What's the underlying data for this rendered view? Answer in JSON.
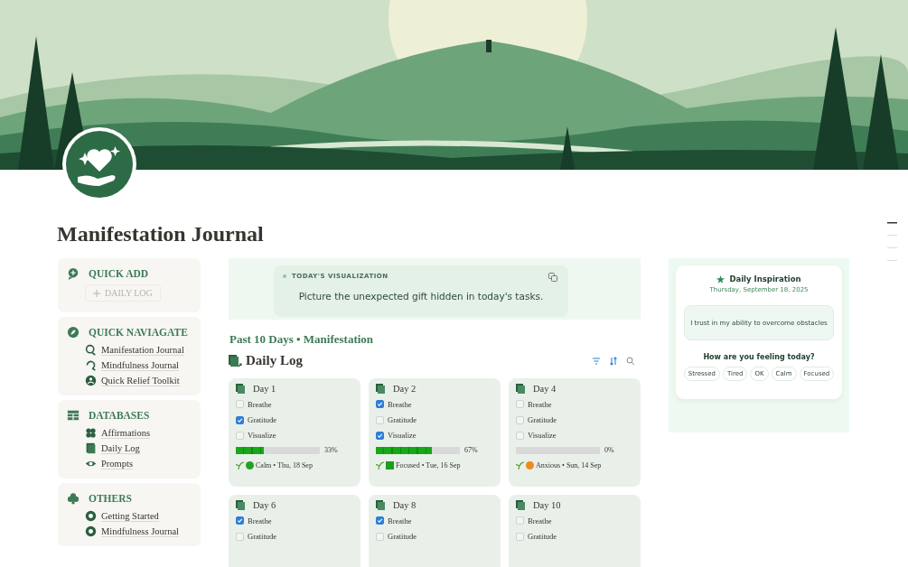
{
  "page": {
    "title": "Manifestation Journal"
  },
  "sidebar": [
    {
      "title": "QUICK ADD",
      "button": "DAILY LOG"
    },
    {
      "title": "QUICK NAVIAGATE",
      "items": [
        "Manifestation Journal",
        "Mindfulness Journal",
        "Quick Relief Toolkit"
      ]
    },
    {
      "title": "DATABASES",
      "items": [
        "Affirmations",
        "Daily Log",
        "Prompts"
      ]
    },
    {
      "title": "OTHERS",
      "items": [
        "Getting Started",
        "Mindfulness Journal"
      ]
    }
  ],
  "visualization": {
    "label": "TODAY'S VISUALIZATION",
    "text": "Picture the unexpected gift hidden in today's tasks."
  },
  "section_title": "Past 10 Days • Manifestation",
  "database": {
    "title": "Daily Log"
  },
  "days": [
    {
      "title": "Day 1",
      "tasks": [
        {
          "label": "Breathe",
          "checked": false
        },
        {
          "label": "Gratitude",
          "checked": true
        },
        {
          "label": "Visualize",
          "checked": false
        }
      ],
      "level": 0.33,
      "percent": "33%",
      "mood": {
        "kind": "circle",
        "color": "#22a322"
      },
      "footer": "Calm • Thu, 18 Sep"
    },
    {
      "title": "Day 2",
      "tasks": [
        {
          "label": "Breathe",
          "checked": true
        },
        {
          "label": "Gratitude",
          "checked": false
        },
        {
          "label": "Visualize",
          "checked": true
        }
      ],
      "level": 0.67,
      "percent": "67%",
      "mood": {
        "kind": "square",
        "color": "#1e9e1e"
      },
      "footer": "Focused • Tue, 16 Sep"
    },
    {
      "title": "Day 4",
      "tasks": [
        {
          "label": "Breathe",
          "checked": false
        },
        {
          "label": "Gratitude",
          "checked": false
        },
        {
          "label": "Visualize",
          "checked": false
        }
      ],
      "level": 0,
      "percent": "0%",
      "mood": {
        "kind": "circle",
        "color": "#f08a1c"
      },
      "footer": "Anxious • Sun, 14 Sep"
    },
    {
      "title": "Day 6",
      "tasks": [
        {
          "label": "Breathe",
          "checked": true
        },
        {
          "label": "Gratitude",
          "checked": false
        }
      ]
    },
    {
      "title": "Day 8",
      "tasks": [
        {
          "label": "Breathe",
          "checked": true
        },
        {
          "label": "Gratitude",
          "checked": false
        }
      ]
    },
    {
      "title": "Day 10",
      "tasks": [
        {
          "label": "Breathe",
          "checked": false
        },
        {
          "label": "Gratitude",
          "checked": false
        }
      ]
    }
  ],
  "inspiration": {
    "title": "Daily Inspiration",
    "date": "Thursday, September 18, 2025",
    "quote": "I trust in my ability to overcome obstacles",
    "question": "How are you feeling today?",
    "moods": [
      "Stressed",
      "Tired",
      "OK",
      "Calm",
      "Focused"
    ]
  }
}
